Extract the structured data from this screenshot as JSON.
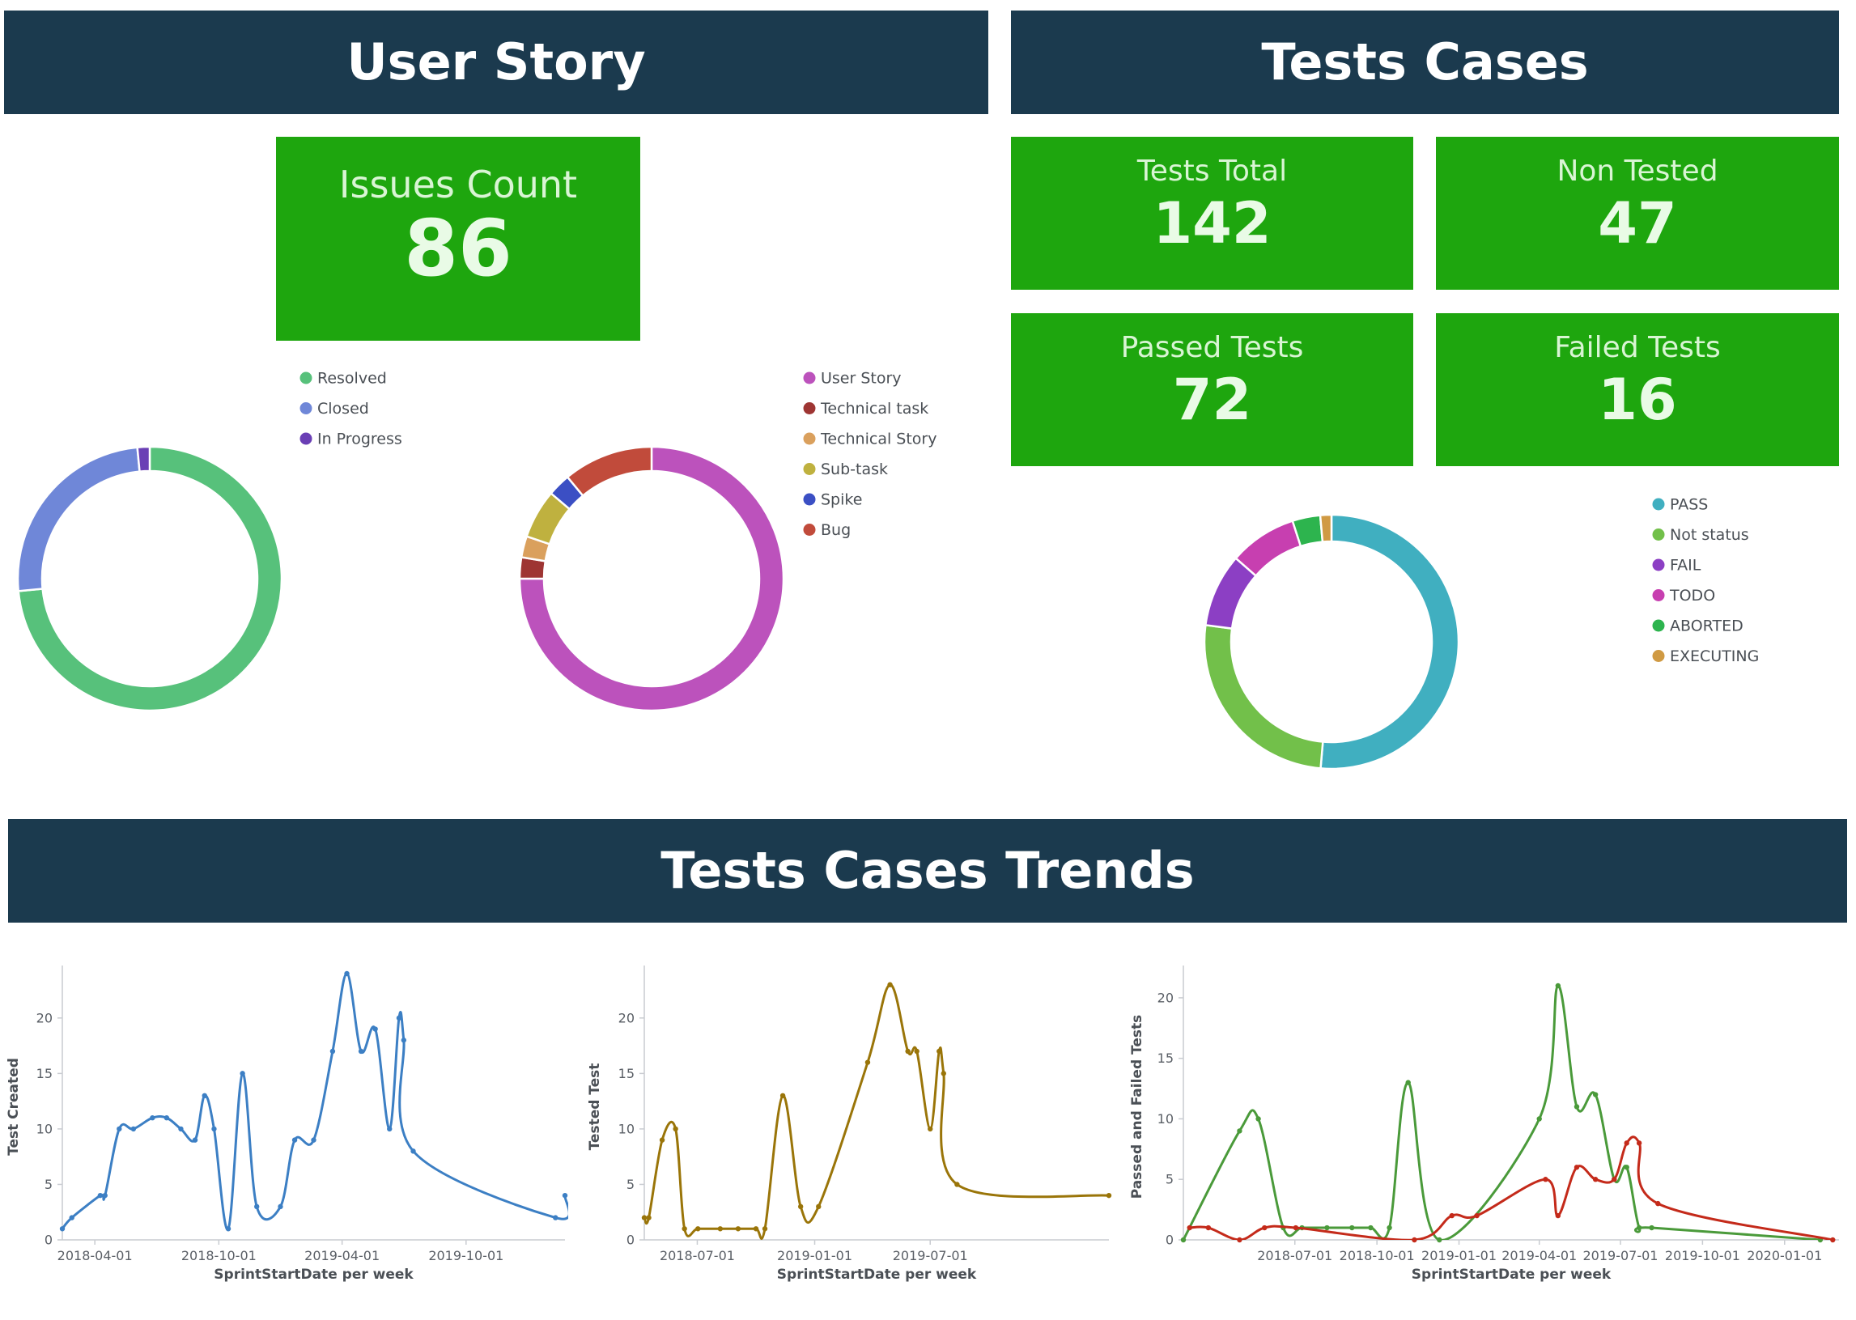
{
  "banners": {
    "user_story": "User Story",
    "tests_cases": "Tests Cases",
    "trends": "Tests Cases Trends"
  },
  "tiles": {
    "issues_count": {
      "label": "Issues Count",
      "value": "86"
    },
    "tests_total": {
      "label": "Tests Total",
      "value": "142"
    },
    "non_tested": {
      "label": "Non Tested",
      "value": "47"
    },
    "passed_tests": {
      "label": "Passed Tests",
      "value": "72"
    },
    "failed_tests": {
      "label": "Failed Tests",
      "value": "16"
    }
  },
  "chart_data": [
    {
      "type": "pie",
      "donut": true,
      "legend_position": "top-right",
      "labels": [
        "Resolved",
        "Closed",
        "In Progress"
      ],
      "values": [
        73.5,
        25,
        1.5
      ],
      "colors": [
        "#57c17b",
        "#6f87d8",
        "#6a3fb5"
      ]
    },
    {
      "type": "pie",
      "donut": true,
      "legend_position": "top-right",
      "labels": [
        "User Story",
        "Technical task",
        "Technical Story",
        "Sub-task",
        "Spike",
        "Bug"
      ],
      "values": [
        75,
        2.6,
        2.6,
        6,
        2.8,
        11
      ],
      "colors": [
        "#bc52bc",
        "#9e3533",
        "#daa05d",
        "#bfb13f",
        "#3b4fc4",
        "#c14b3b"
      ]
    },
    {
      "type": "pie",
      "donut": true,
      "legend_position": "right",
      "labels": [
        "PASS",
        "Not status",
        "FAIL",
        "TODO",
        "ABORTED",
        "EXECUTING"
      ],
      "values": [
        50.7,
        25.4,
        9.2,
        8.5,
        3.5,
        1.4
      ],
      "colors": [
        "#40afc0",
        "#72c04a",
        "#8c3fc4",
        "#c73fb0",
        "#2db44e",
        "#d09a43"
      ]
    },
    {
      "type": "line",
      "xlabel": "SprintStartDate per week",
      "ylabel": "Test Created",
      "xlim": [
        "2018-02-12",
        "2020-02-24"
      ],
      "ylim": [
        0,
        24
      ],
      "yticks": [
        0,
        5,
        10,
        15,
        20
      ],
      "xticks": [
        "2018-04-01",
        "2018-10-01",
        "2019-04-01",
        "2019-10-01"
      ],
      "series": [
        {
          "color": "#3c7fc4",
          "points": [
            [
              "2018-02-12",
              1
            ],
            [
              "2018-02-26",
              2
            ],
            [
              "2018-04-09",
              4
            ],
            [
              "2018-04-16",
              4
            ],
            [
              "2018-05-07",
              10
            ],
            [
              "2018-05-28",
              10
            ],
            [
              "2018-06-25",
              11
            ],
            [
              "2018-07-16",
              11
            ],
            [
              "2018-08-06",
              10
            ],
            [
              "2018-08-27",
              9
            ],
            [
              "2018-09-10",
              13
            ],
            [
              "2018-09-24",
              10
            ],
            [
              "2018-10-15",
              1
            ],
            [
              "2018-11-05",
              15
            ],
            [
              "2018-11-26",
              3
            ],
            [
              "2018-12-31",
              3
            ],
            [
              "2019-01-21",
              9
            ],
            [
              "2019-02-18",
              9
            ],
            [
              "2019-03-18",
              17
            ],
            [
              "2019-04-08",
              24
            ],
            [
              "2019-04-29",
              17
            ],
            [
              "2019-05-20",
              19
            ],
            [
              "2019-06-10",
              10
            ],
            [
              "2019-06-24",
              20
            ],
            [
              "2019-07-01",
              18
            ],
            [
              "2019-07-15",
              8
            ],
            [
              "2020-02-10",
              2
            ],
            [
              "2020-02-24",
              4
            ]
          ]
        }
      ]
    },
    {
      "type": "line",
      "xlabel": "SprintStartDate per week",
      "ylabel": "Tested Test",
      "xlim": [
        "2018-04-09",
        "2020-04-06"
      ],
      "ylim": [
        0,
        24
      ],
      "yticks": [
        0,
        5,
        10,
        15,
        20
      ],
      "xticks": [
        "2018-07-01",
        "2019-01-01",
        "2019-07-01"
      ],
      "series": [
        {
          "color": "#9a7509",
          "points": [
            [
              "2018-04-09",
              2
            ],
            [
              "2018-04-16",
              2
            ],
            [
              "2018-05-07",
              9
            ],
            [
              "2018-05-28",
              10
            ],
            [
              "2018-06-11",
              1
            ],
            [
              "2018-07-02",
              1
            ],
            [
              "2018-08-06",
              1
            ],
            [
              "2018-09-03",
              1
            ],
            [
              "2018-10-01",
              1
            ],
            [
              "2018-10-15",
              1
            ],
            [
              "2018-11-12",
              13
            ],
            [
              "2018-12-10",
              3
            ],
            [
              "2019-01-07",
              3
            ],
            [
              "2019-03-25",
              16
            ],
            [
              "2019-04-29",
              23
            ],
            [
              "2019-05-27",
              17
            ],
            [
              "2019-06-10",
              17
            ],
            [
              "2019-07-01",
              10
            ],
            [
              "2019-07-15",
              17
            ],
            [
              "2019-07-22",
              15
            ],
            [
              "2019-08-12",
              5
            ],
            [
              "2020-04-06",
              4
            ]
          ]
        }
      ]
    },
    {
      "type": "line",
      "xlabel": "SprintStartDate per week",
      "ylabel": "Passed and Failed Tests",
      "xlim": [
        "2018-02-26",
        "2020-03-02"
      ],
      "ylim": [
        0,
        22
      ],
      "yticks": [
        0,
        5,
        10,
        15,
        20
      ],
      "xticks": [
        "2018-07-01",
        "2018-10-01",
        "2019-01-01",
        "2019-04-01",
        "2019-07-01",
        "2019-10-01",
        "2020-01-01"
      ],
      "series": [
        {
          "color": "#4a9a3a",
          "points": [
            [
              "2018-02-26",
              0
            ],
            [
              "2018-04-30",
              9
            ],
            [
              "2018-05-21",
              10
            ],
            [
              "2018-06-18",
              1
            ],
            [
              "2018-07-09",
              1
            ],
            [
              "2018-08-06",
              1
            ],
            [
              "2018-09-03",
              1
            ],
            [
              "2018-09-24",
              1
            ],
            [
              "2018-10-15",
              1
            ],
            [
              "2018-11-05",
              13
            ],
            [
              "2018-12-10",
              0
            ],
            [
              "2019-04-01",
              10
            ],
            [
              "2019-04-22",
              21
            ],
            [
              "2019-05-13",
              11
            ],
            [
              "2019-06-03",
              12
            ],
            [
              "2019-06-24",
              5
            ],
            [
              "2019-07-08",
              6
            ],
            [
              "2019-07-22",
              1
            ],
            [
              "2019-08-05",
              1
            ],
            [
              "2020-02-10",
              0
            ]
          ]
        },
        {
          "color": "#c42a1a",
          "points": [
            [
              "2018-03-05",
              1
            ],
            [
              "2018-03-26",
              1
            ],
            [
              "2018-04-30",
              0
            ],
            [
              "2018-05-28",
              1
            ],
            [
              "2018-07-02",
              1
            ],
            [
              "2018-11-12",
              0
            ],
            [
              "2018-12-24",
              2
            ],
            [
              "2019-01-21",
              2
            ],
            [
              "2019-04-08",
              5
            ],
            [
              "2019-04-22",
              2
            ],
            [
              "2019-05-13",
              6
            ],
            [
              "2019-06-03",
              5
            ],
            [
              "2019-06-24",
              5
            ],
            [
              "2019-07-08",
              8
            ],
            [
              "2019-07-22",
              8
            ],
            [
              "2019-08-12",
              3
            ],
            [
              "2020-02-24",
              0
            ]
          ]
        }
      ]
    }
  ]
}
